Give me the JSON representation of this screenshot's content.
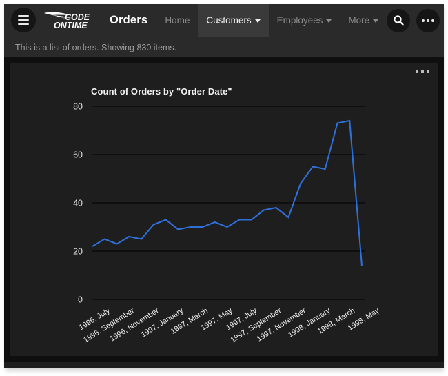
{
  "window": {
    "frame_color": "#ffffff",
    "app_background": "#1e1e1e",
    "content_background": "#0f0f0f"
  },
  "navbar": {
    "menu_icon": "hamburger-icon",
    "logo": {
      "line1": "CODE",
      "line2": "ONTIME",
      "mark": "wing-swoosh-icon"
    },
    "page_title": "Orders",
    "items": [
      {
        "label": "Home",
        "has_caret": false,
        "active": false
      },
      {
        "label": "Customers",
        "has_caret": true,
        "active": true
      },
      {
        "label": "Employees",
        "has_caret": true,
        "active": false
      },
      {
        "label": "More",
        "has_caret": true,
        "active": false
      }
    ],
    "search_icon": "search-icon",
    "overflow_icon": "more-horizontal-icon",
    "active_tab_background": "#3a3a3a",
    "background": "#2a2a2a"
  },
  "description": {
    "text": "This is a list of orders. Showing 830 items."
  },
  "panel": {
    "menu_icon": "more-horizontal-icon"
  },
  "chart_data": {
    "type": "line",
    "title": "Count of Orders by \"Order Date\"",
    "xlabel": "",
    "ylabel": "",
    "ylim": [
      0,
      80
    ],
    "yticks": [
      0,
      20,
      40,
      60,
      80
    ],
    "grid": true,
    "legend": "none",
    "line_color": "#2f6fd8",
    "categories": [
      "1996, July",
      "1996, August",
      "1996, September",
      "1996, October",
      "1996, November",
      "1996, December",
      "1997, January",
      "1997, February",
      "1997, March",
      "1997, April",
      "1997, May",
      "1997, June",
      "1997, July",
      "1997, August",
      "1997, September",
      "1997, October",
      "1997, November",
      "1997, December",
      "1998, January",
      "1998, February",
      "1998, March",
      "1998, April",
      "1998, May"
    ],
    "tick_labels": [
      "1996, July",
      "1996, September",
      "1996, November",
      "1997, January",
      "1997, March",
      "1997, May",
      "1997, July",
      "1997, September",
      "1997, November",
      "1998, January",
      "1998, March",
      "1998, May"
    ],
    "values": [
      22,
      25,
      23,
      26,
      25,
      31,
      33,
      29,
      30,
      30,
      32,
      30,
      33,
      33,
      37,
      38,
      34,
      48,
      55,
      54,
      73,
      74,
      14
    ]
  }
}
